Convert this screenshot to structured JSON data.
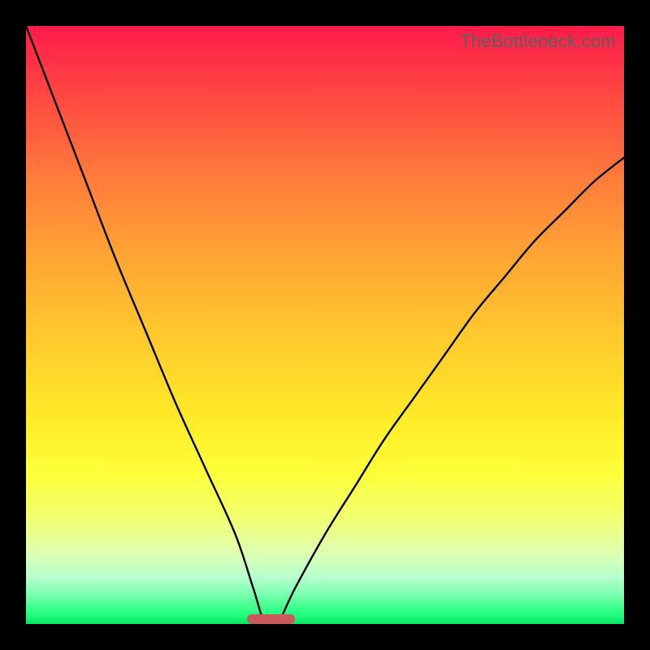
{
  "watermark": "TheBottleneck.com",
  "colors": {
    "curve": "#000000",
    "marker": "#c85a5a",
    "frame": "#000000"
  },
  "chart_data": {
    "type": "line",
    "title": "",
    "xlabel": "",
    "ylabel": "",
    "xlim": [
      0,
      100
    ],
    "ylim": [
      0,
      100
    ],
    "x": [
      0,
      5,
      10,
      15,
      20,
      25,
      30,
      35,
      38,
      40,
      42,
      45,
      50,
      55,
      60,
      65,
      70,
      75,
      80,
      85,
      90,
      95,
      100
    ],
    "values": [
      100,
      87,
      74,
      61,
      49,
      37,
      26,
      15,
      6,
      0,
      0,
      6,
      15,
      23,
      31,
      38,
      45,
      52,
      58,
      64,
      69,
      74,
      78
    ],
    "optimal_x": 41,
    "optimal_width": 8,
    "annotations": [
      "TheBottleneck.com"
    ]
  }
}
